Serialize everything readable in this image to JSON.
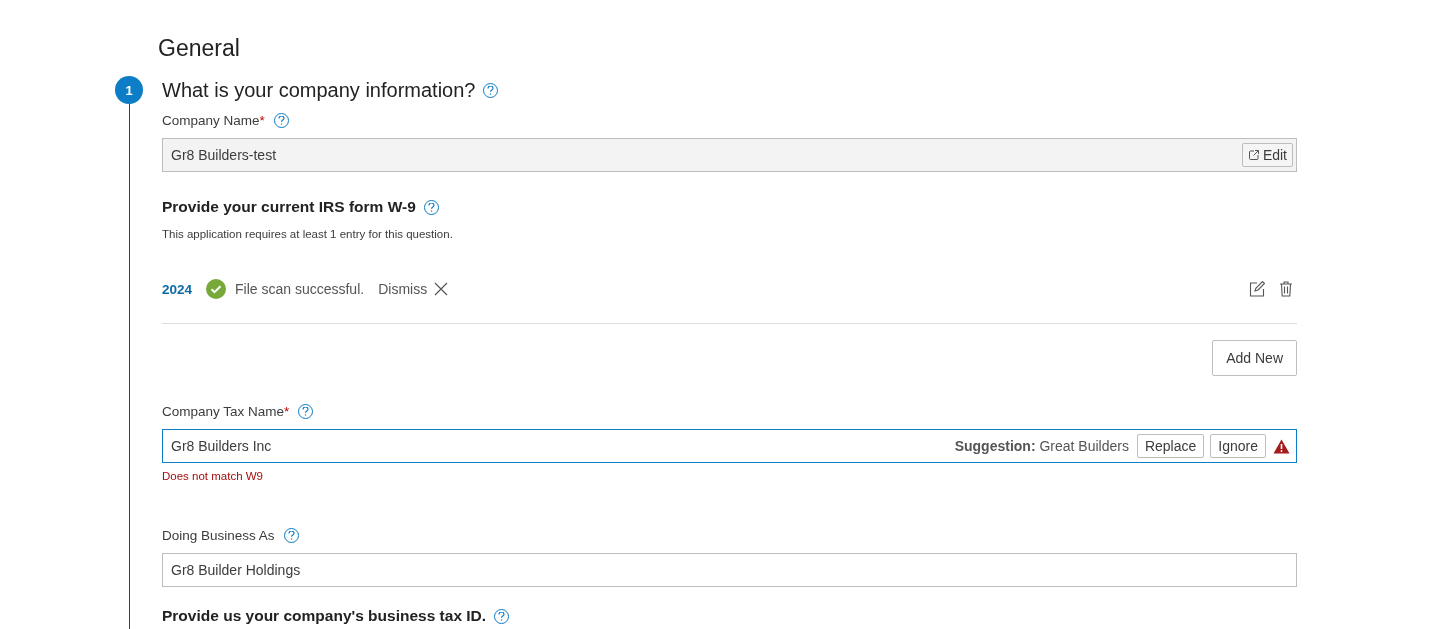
{
  "section_title": "General",
  "step": {
    "number": "1",
    "question": "What is your company information?"
  },
  "company_name": {
    "label": "Company Name",
    "required_mark": "*",
    "value": "Gr8 Builders-test",
    "readonly": true,
    "edit_button": "Edit"
  },
  "w9": {
    "heading": "Provide your current IRS form W-9",
    "note": "This application requires at least 1 entry for this question.",
    "entries": [
      {
        "year": "2024",
        "status": "File scan successful.",
        "dismiss": "Dismiss"
      }
    ],
    "add_button": "Add New"
  },
  "tax_name": {
    "label": "Company Tax Name",
    "required_mark": "*",
    "value": "Gr8 Builders Inc",
    "suggestion_label": "Suggestion:",
    "suggestion": "Great Builders",
    "replace_button": "Replace",
    "ignore_button": "Ignore",
    "error": "Does not match W9"
  },
  "dba": {
    "label": "Doing Business As",
    "value": "Gr8 Builder Holdings"
  },
  "tax_id": {
    "heading": "Provide us your company's business tax ID."
  }
}
